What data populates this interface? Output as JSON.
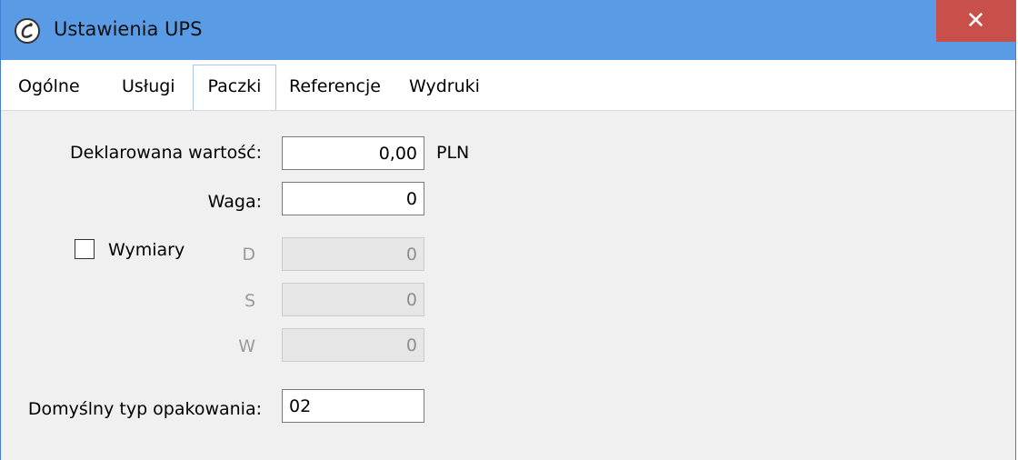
{
  "window": {
    "title": "Ustawienia UPS",
    "close_glyph": "✕",
    "app_icon": "app-logo-icon"
  },
  "tabs": [
    {
      "label": "Ogólne",
      "active": false
    },
    {
      "label": "Usługi",
      "active": false
    },
    {
      "label": "Paczki",
      "active": true
    },
    {
      "label": "Referencje",
      "active": false
    },
    {
      "label": "Wydruki",
      "active": false
    }
  ],
  "form": {
    "declared_value": {
      "label": "Deklarowana wartość:",
      "value": "0,00",
      "unit": "PLN"
    },
    "weight": {
      "label": "Waga:",
      "value": "0"
    },
    "dimensions": {
      "checkbox_label": "Wymiary",
      "checked": false,
      "length": {
        "label": "D",
        "value": "0"
      },
      "width": {
        "label": "S",
        "value": "0"
      },
      "height": {
        "label": "W",
        "value": "0"
      }
    },
    "package_type": {
      "label": "Domyślny typ opakowania:",
      "value": "02"
    }
  },
  "colors": {
    "titlebar": "#5a9be5",
    "close_button": "#c9504a",
    "window_background": "#f0f0f0"
  }
}
